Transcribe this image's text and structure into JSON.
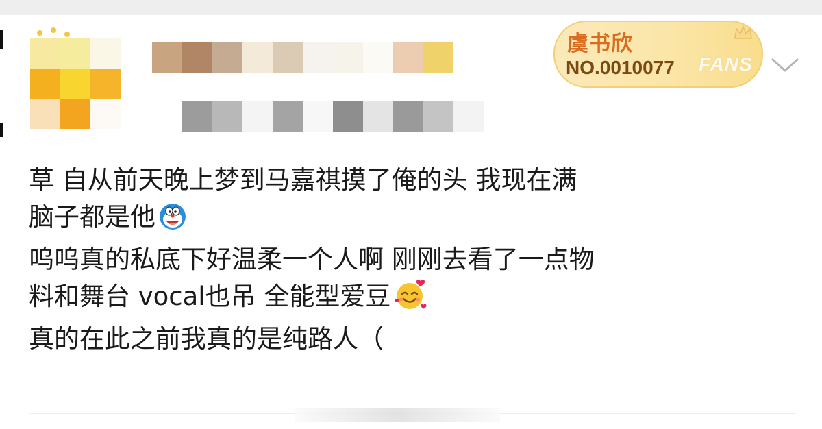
{
  "badge": {
    "name": "虞书欣",
    "number": "NO.0010077",
    "tag": "FANS"
  },
  "post": {
    "lines": [
      "草 自从前天晚上梦到马嘉祺摸了俺的头 我现在满",
      "脑子都是他",
      "呜呜真的私底下好温柔一个人啊 刚刚去看了一点物",
      "料和舞台 vocal也吊 全能型爱豆",
      "真的在此之前我真的是纯路人（"
    ]
  },
  "icons": {
    "emoji_1": "doraemon-emoji-icon",
    "emoji_2": "smiling-face-with-hearts-emoji-icon",
    "more": "chevron-down-icon",
    "badge_decoration": "crown-icon"
  },
  "colors": {
    "badge_name": "#d96c1f",
    "badge_number": "#7a4a12",
    "text": "#1a1a1a",
    "badge_bg": "#fbe6a8"
  }
}
